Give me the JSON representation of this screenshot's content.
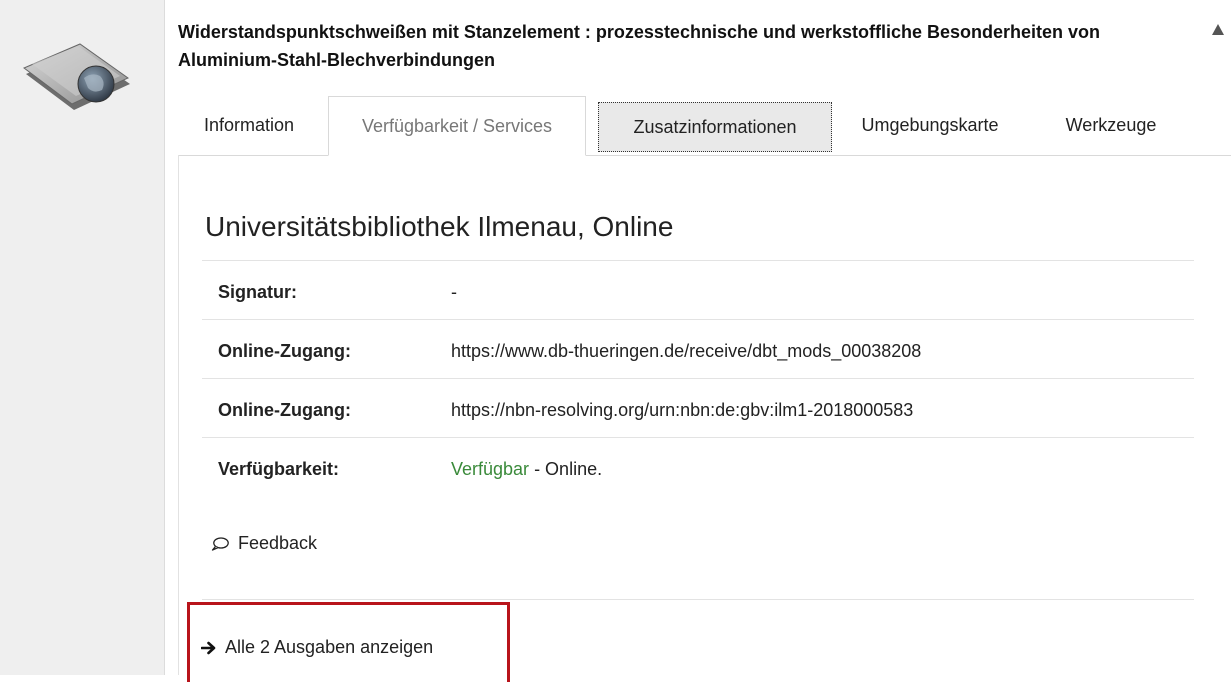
{
  "record": {
    "title": "Widerstandspunktschweißen mit Stanzelement : prozesstechnische und werkstoffliche Besonderheiten von Aluminium-Stahl-Blechverbindungen",
    "icon": "online-resource-folder-icon"
  },
  "tabs": [
    {
      "label": "Information"
    },
    {
      "label": "Verfügbarkeit / Services"
    },
    {
      "label": "Zusatzinformationen"
    },
    {
      "label": "Umgebungskarte"
    },
    {
      "label": "Werkzeuge"
    }
  ],
  "holding": {
    "library_name": "Universitätsbibliothek Ilmenau, Online",
    "rows": [
      {
        "label": "Signatur:",
        "value": "-"
      },
      {
        "label": "Online-Zugang:",
        "value": "https://www.db-thueringen.de/receive/dbt_mods_00038208"
      },
      {
        "label": "Online-Zugang:",
        "value": "https://nbn-resolving.org/urn:nbn:de:gbv:ilm1-2018000583"
      },
      {
        "label": "Verfügbarkeit:",
        "value_link": "Verfügbar",
        "value_rest": " - Online."
      }
    ]
  },
  "feedback_label": "Feedback",
  "all_editions_label": "Alle 2 Ausgaben anzeigen",
  "colors": {
    "available": "#3a8a3a",
    "highlight": "#b8141b"
  }
}
